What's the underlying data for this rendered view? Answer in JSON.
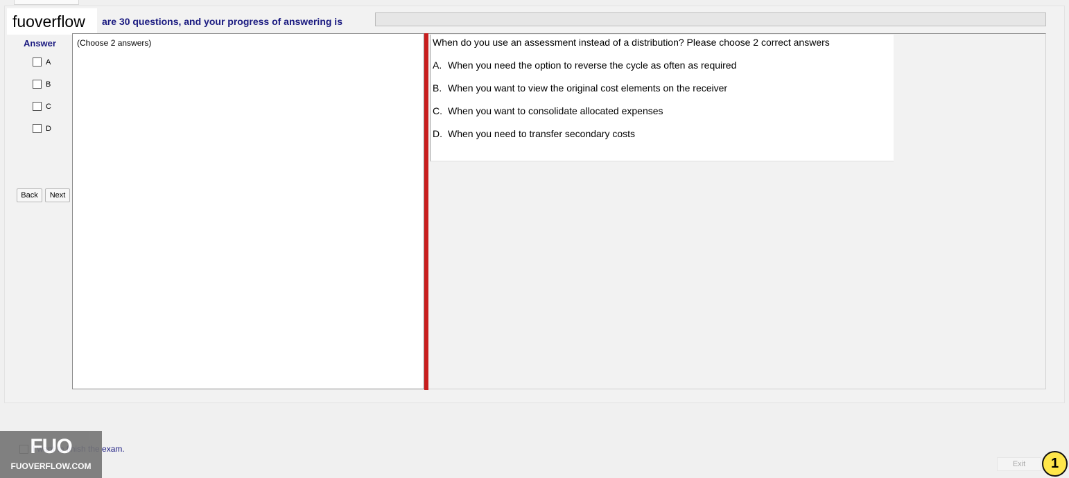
{
  "brand": {
    "label": "fuoverflow"
  },
  "progress": {
    "text": "are 30 questions, and your progress of answering is",
    "fraction": 0
  },
  "answer_panel": {
    "heading": "Answer",
    "options": [
      {
        "label": "A",
        "checked": false
      },
      {
        "label": "B",
        "checked": false
      },
      {
        "label": "C",
        "checked": false
      },
      {
        "label": "D",
        "checked": false
      }
    ],
    "back_label": "Back",
    "next_label": "Next"
  },
  "left_pane": {
    "note": "(Choose 2 answers)"
  },
  "question": {
    "stem": "When do you use an assessment instead of a distribution? Please choose 2 correct answers",
    "choices": [
      {
        "letter": "A.",
        "text": "When you need the option to reverse the cycle as often as required"
      },
      {
        "letter": "B.",
        "text": "When you want to view the original cost elements on the receiver"
      },
      {
        "letter": "C.",
        "text": "When you want to consolidate allocated expenses"
      },
      {
        "letter": "D.",
        "text": "When you need to transfer secondary costs"
      }
    ]
  },
  "finish": {
    "text": "I want to finish the exam.",
    "checked": false
  },
  "watermark": {
    "logo": "FUO",
    "site": "FUOVERFLOW.COM"
  },
  "exit_label": "Exit",
  "badge": "1",
  "colors": {
    "accent_text": "#1a1a80",
    "splitter": "#c81e1e",
    "badge": "#ffe74a"
  }
}
